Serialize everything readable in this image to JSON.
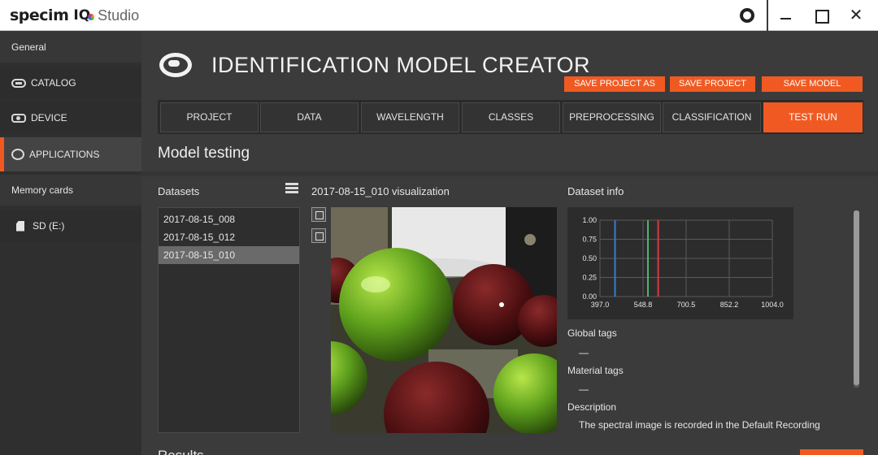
{
  "app": {
    "brand": "specim",
    "brand_iq": "IQ",
    "brand_studio": "Studio"
  },
  "sidebar": {
    "general": "General",
    "catalog": "CATALOG",
    "device": "DEVICE",
    "applications": "APPLICATIONS",
    "memory_cards": "Memory cards",
    "sd": "SD (E:)"
  },
  "header": {
    "title": "IDENTIFICATION MODEL CREATOR",
    "save_project_as": "SAVE PROJECT AS",
    "save_project": "SAVE PROJECT",
    "save_model": "SAVE MODEL"
  },
  "tabs": [
    "PROJECT",
    "DATA",
    "WAVELENGTH",
    "CLASSES",
    "PREPROCESSING",
    "CLASSIFICATION",
    "TEST RUN"
  ],
  "active_tab": "TEST RUN",
  "section_title": "Model testing",
  "datasets": {
    "label": "Datasets",
    "items": [
      "2017-08-15_008",
      "2017-08-15_012",
      "2017-08-15_010"
    ],
    "selected": "2017-08-15_010"
  },
  "visualization": {
    "label": "2017-08-15_010 visualization"
  },
  "dataset_info": {
    "label": "Dataset info",
    "global_tags_label": "Global tags",
    "global_tags_value": "—",
    "material_tags_label": "Material tags",
    "material_tags_value": "—",
    "description_label": "Description",
    "description_text": "The spectral image is recorded in the Default Recording"
  },
  "results_label": "Results",
  "chart_data": {
    "type": "line",
    "x_ticks": [
      "397.0",
      "548.8",
      "700.5",
      "852.2",
      "1004.0"
    ],
    "y_ticks": [
      "0.00",
      "0.25",
      "0.50",
      "0.75",
      "1.00"
    ],
    "xlim": [
      397.0,
      1004.0
    ],
    "ylim": [
      0,
      1
    ],
    "grid": true,
    "series": [
      {
        "x": 450,
        "color": "#2f7fd2"
      },
      {
        "x": 566,
        "color": "#4fb86a"
      },
      {
        "x": 602,
        "color": "#d83a3a"
      }
    ]
  },
  "colors": {
    "accent": "#f05a22",
    "background": "#3b3b3b",
    "sidebar": "#2f2f2f"
  }
}
